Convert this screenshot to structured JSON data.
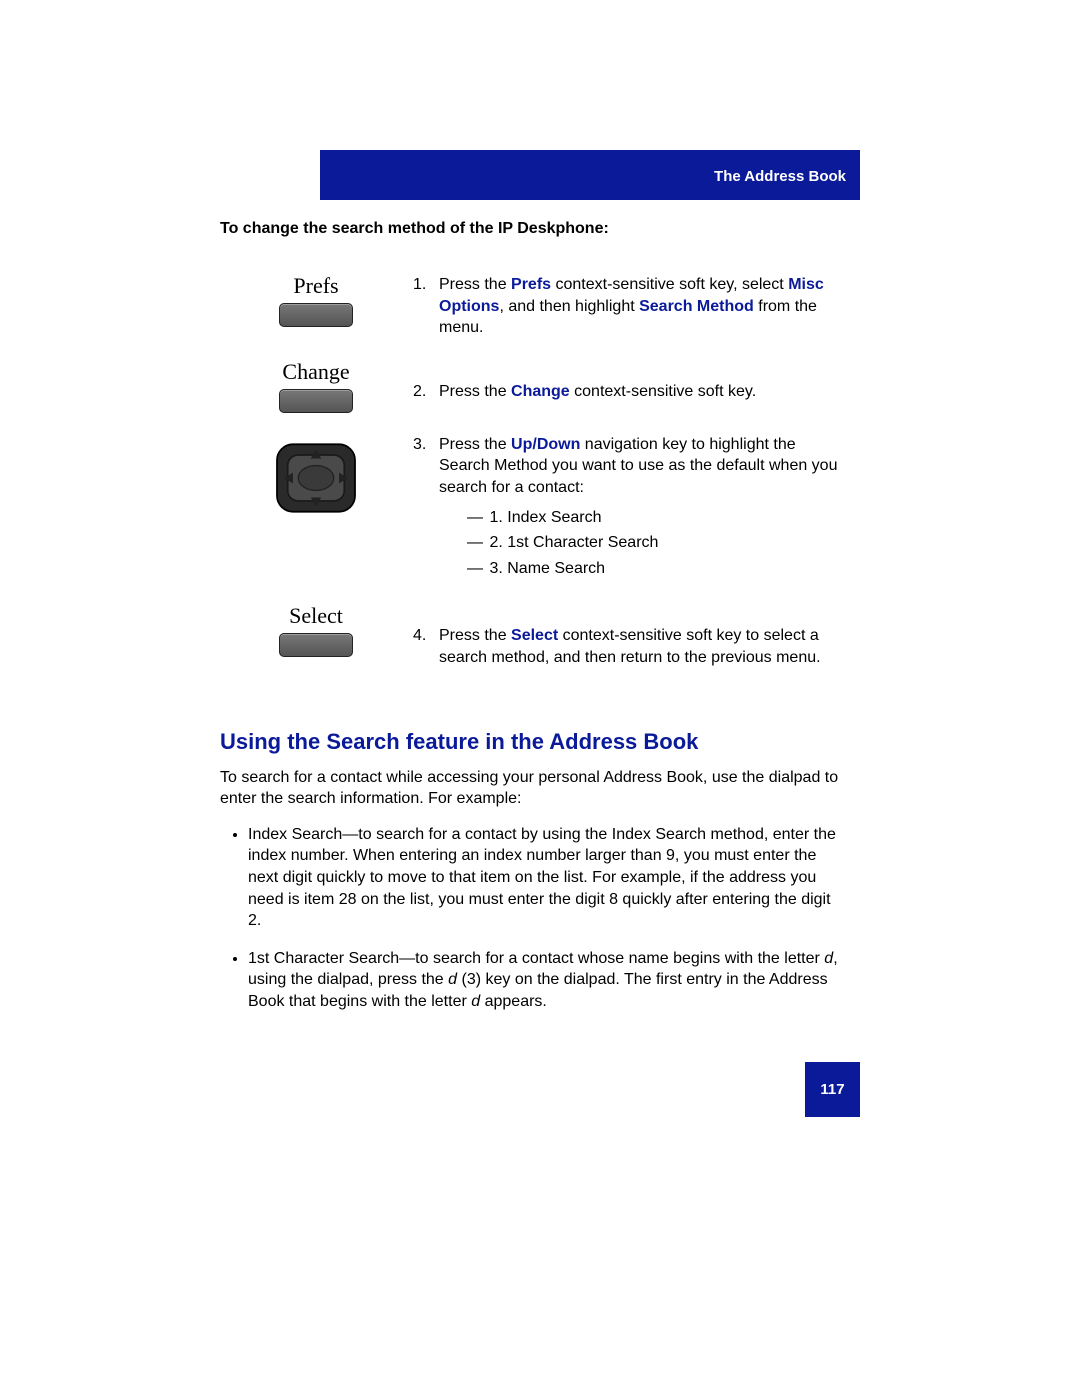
{
  "header": {
    "title": "The Address Book"
  },
  "intro": "To change the search method of the IP Deskphone:",
  "keys": {
    "prefs": "Prefs",
    "change": "Change",
    "select": "Select"
  },
  "steps": {
    "s1": {
      "num": "1.",
      "pre": "Press the ",
      "b1": "Prefs",
      "mid1": " context-sensitive soft key, select ",
      "b2": "Misc Options",
      "mid2": ", and then highlight ",
      "b3": "Search Method",
      "post": " from the menu."
    },
    "s2": {
      "num": "2.",
      "pre": "Press the ",
      "b1": "Change",
      "post": " context-sensitive soft key."
    },
    "s3": {
      "num": "3.",
      "pre": "Press the ",
      "b1": "Up",
      "slash": "/",
      "b2": "Down",
      "post": " navigation key to highlight the Search Method you want to use as the default when you search for a contact:",
      "items": [
        "1. Index Search",
        "2. 1st Character Search",
        "3. Name Search"
      ]
    },
    "s4": {
      "num": "4.",
      "pre": "Press the ",
      "b1": "Select",
      "post": " context-sensitive soft key to select a search method, and then return to the previous menu."
    }
  },
  "section2": {
    "heading": "Using the Search feature in the Address Book",
    "para": "To search for a contact while accessing your personal Address Book, use the dialpad to enter the search information. For example:",
    "bullets": {
      "b1": "Index Search—to search for a contact by using the Index Search method, enter the index number. When entering an index number larger than 9, you must enter the next digit quickly to move to that item on the list. For example, if the address you need is item 28 on the list, you must enter the digit 8 quickly after entering the digit 2.",
      "b2_pre": "1st Character Search—to search for a contact whose name begins with the letter ",
      "b2_it1": "d",
      "b2_mid1": ", using the dialpad, press the ",
      "b2_it2": "d",
      "b2_mid2": " (3) key on the dialpad. The first entry in the Address Book that begins with the letter ",
      "b2_it3": "d",
      "b2_post": " appears."
    }
  },
  "page_number": "117"
}
